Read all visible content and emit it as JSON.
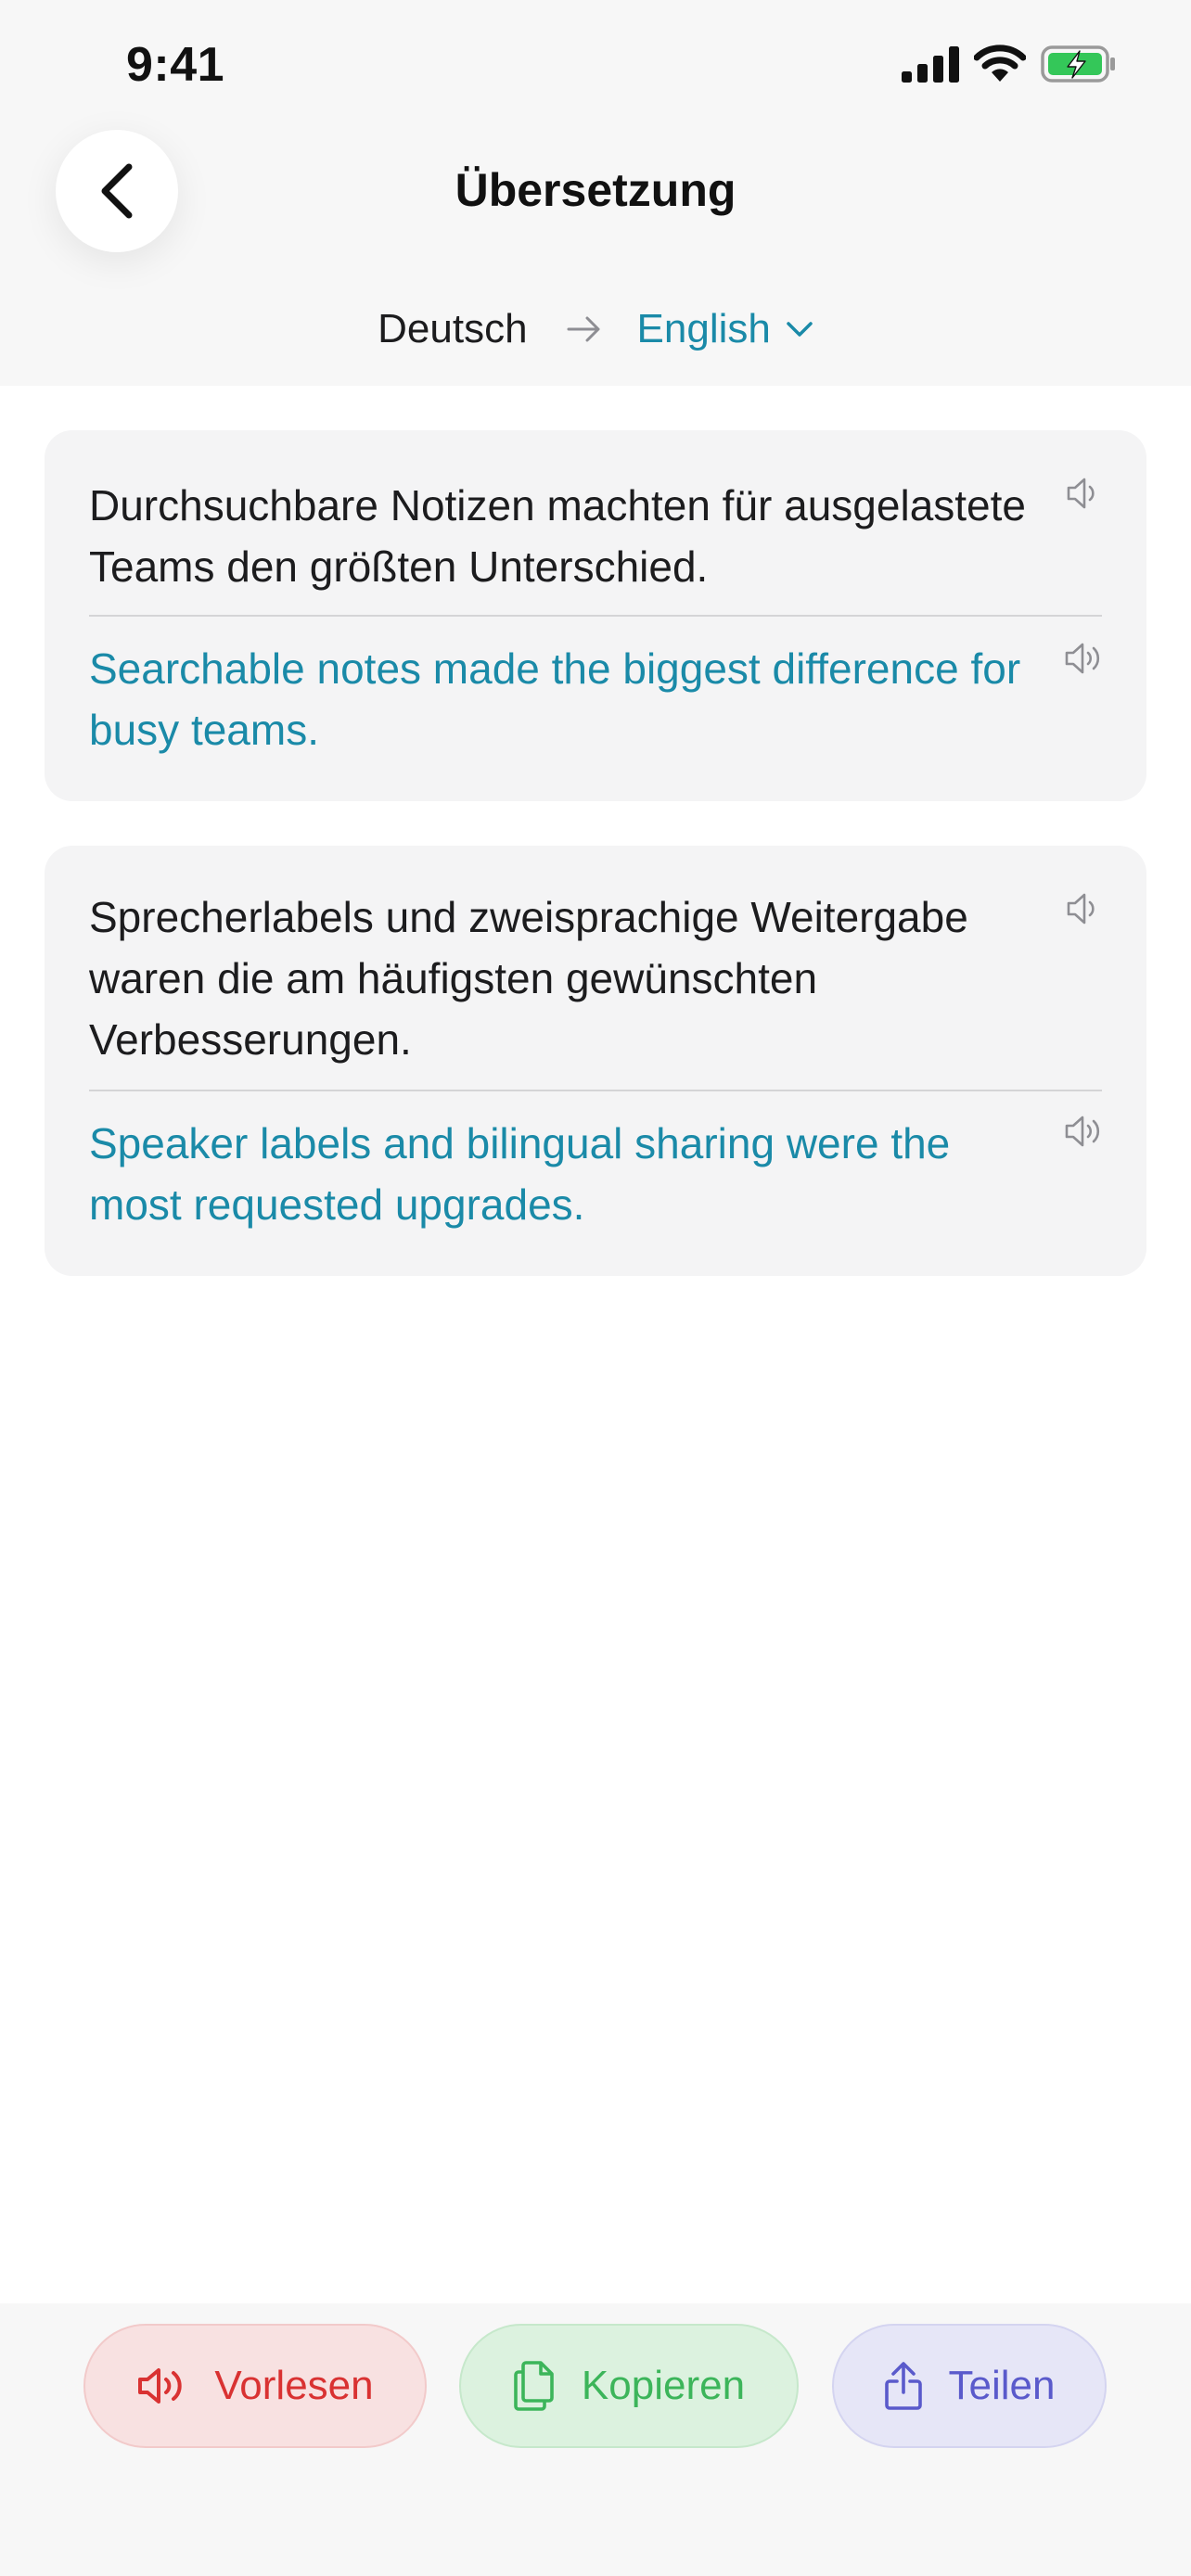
{
  "status_bar": {
    "time": "9:41"
  },
  "header": {
    "title": "Übersetzung",
    "source_language": "Deutsch",
    "target_language": "English"
  },
  "segments": [
    {
      "source": "Durchsuchbare Notizen machten für ausgelastete Teams den größten Unterschied.",
      "translation": "Searchable notes made the biggest difference for busy teams."
    },
    {
      "source": "Sprecherlabels und zweisprachige Weitergabe waren die am häufigsten gewünschten Verbesserungen.",
      "translation": "Speaker labels and bilingual sharing were the most requested upgrades."
    }
  ],
  "actions": {
    "read_aloud": "Vorlesen",
    "copy": "Kopieren",
    "share": "Teilen"
  },
  "colors": {
    "accent": "#1a8aa8",
    "read_aloud": "#d93232",
    "copy": "#3cb55a",
    "share": "#5a5acb",
    "battery": "#34c759"
  },
  "icons": {
    "back": "chevron-left-icon",
    "arrow": "arrow-right-icon",
    "dropdown": "chevron-down-icon",
    "speaker": "speaker-icon",
    "copy": "copy-icon",
    "share": "share-icon"
  }
}
